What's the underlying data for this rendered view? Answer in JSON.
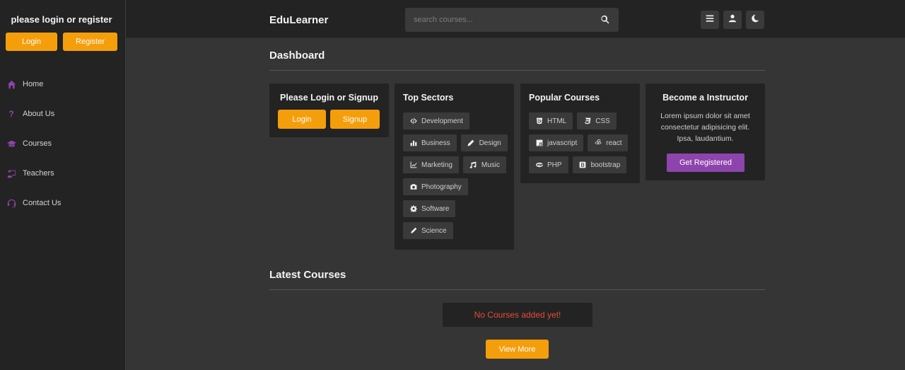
{
  "sidebar": {
    "title": "please login or register",
    "login_label": "Login",
    "register_label": "Register",
    "items": [
      {
        "label": "Home",
        "icon": "home-icon"
      },
      {
        "label": "About Us",
        "icon": "question-icon"
      },
      {
        "label": "Courses",
        "icon": "graduation-cap-icon"
      },
      {
        "label": "Teachers",
        "icon": "chalkboard-teacher-icon"
      },
      {
        "label": "Contact Us",
        "icon": "headset-icon"
      }
    ]
  },
  "header": {
    "logo": "EduLearner",
    "search_placeholder": "search courses...",
    "icons": [
      "menu-icon",
      "user-icon",
      "moon-icon"
    ]
  },
  "dashboard": {
    "title": "Dashboard",
    "login_card": {
      "title": "Please Login or Signup",
      "login_label": "Login",
      "signup_label": "Signup"
    },
    "top_sectors": {
      "title": "Top Sectors",
      "tags": [
        "Development",
        "Business",
        "Design",
        "Marketing",
        "Music",
        "Photography",
        "Software",
        "Science"
      ]
    },
    "popular_courses": {
      "title": "Popular Courses",
      "tags": [
        "HTML",
        "CSS",
        "javascript",
        "react",
        "PHP",
        "bootstrap"
      ]
    },
    "instructor": {
      "title": "Become a Instructor",
      "description": "Lorem ipsum dolor sit amet consectetur adipisicing elit. Ipsa, laudantium.",
      "button_label": "Get Registered"
    }
  },
  "latest_courses": {
    "title": "Latest Courses",
    "empty_message": "No Courses added yet!",
    "view_more_label": "View More"
  },
  "colors": {
    "accent_orange": "#f59e0b",
    "accent_purple": "#8e44ad",
    "error_red": "#e74c3c",
    "background": "#353535",
    "panel": "#232323"
  }
}
